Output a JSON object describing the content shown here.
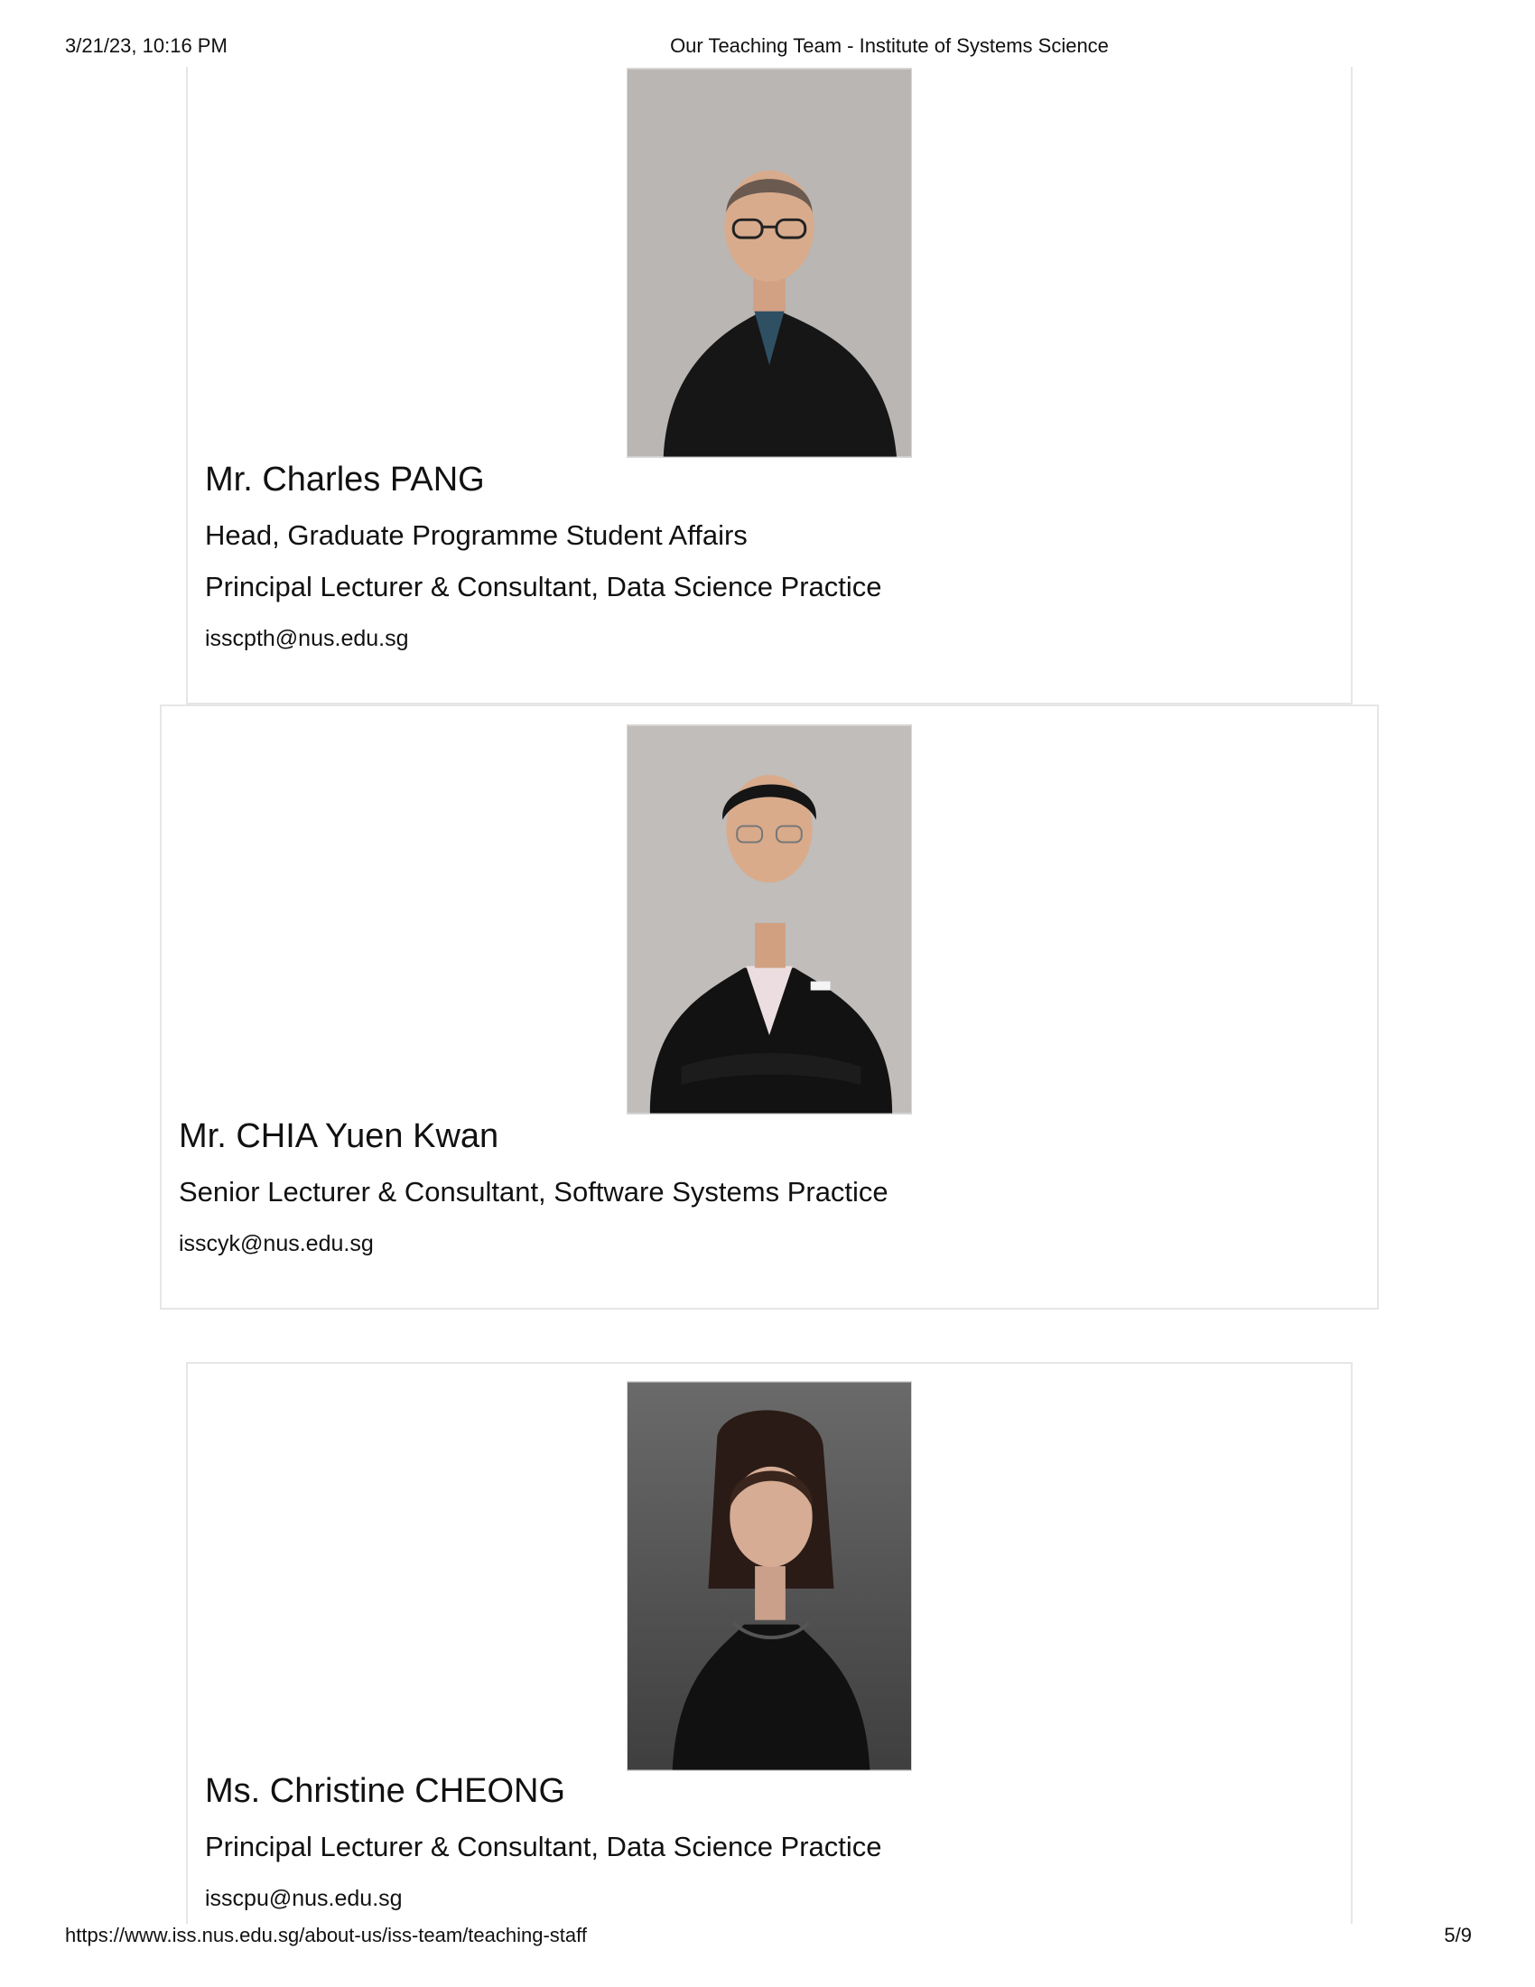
{
  "print_header": {
    "datetime": "3/21/23, 10:16 PM",
    "page_title": "Our Teaching Team - Institute of Systems Science"
  },
  "print_footer": {
    "url": "https://www.iss.nus.edu.sg/about-us/iss-team/teaching-staff",
    "page_number": "5/9"
  },
  "staff": [
    {
      "name": "Mr. Charles PANG",
      "roles": [
        "Head, Graduate Programme Student Affairs",
        "Principal Lecturer & Consultant, Data Science Practice"
      ],
      "email": "isscpth@nus.edu.sg"
    },
    {
      "name": "Mr. CHIA Yuen Kwan",
      "roles": [
        "Senior Lecturer & Consultant, Software Systems Practice"
      ],
      "email": "isscyk@nus.edu.sg"
    },
    {
      "name": "Ms. Christine CHEONG",
      "roles": [
        "Principal Lecturer & Consultant, Data Science Practice"
      ],
      "email": "isscpu@nus.edu.sg"
    }
  ]
}
